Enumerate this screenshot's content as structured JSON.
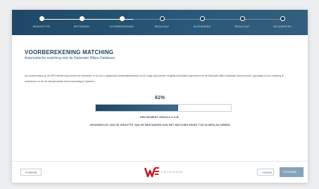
{
  "stepper": {
    "steps": [
      {
        "label": "WONINGTYPE"
      },
      {
        "label": "BESTANDEN"
      },
      {
        "label": "VOORBEREKENING"
      },
      {
        "label": "RESULTAAT"
      },
      {
        "label": "WIJZIGINGEN"
      },
      {
        "label": "RESULTAAT"
      },
      {
        "label": "DOCUMENTEN"
      }
    ],
    "completed_steps": 3
  },
  "main": {
    "title": "VOORBEREKENING MATCHING",
    "subtitle": "Automatische matching met de Nationale Milieu Database",
    "paragraph": "Als voorbereiding op de MPG Berekening worden de elementen in de door u geüploade bestandsbestanden uit de vorige stap worden mogelijk automatisch gematcht met de Nationale Milieu Database (hierna wordt u gevraagd om de matching te controleren en om de niet gematchte items handmatig te matchen.",
    "progress_label": "61%",
    "progress_value": 61,
    "wait_text": "EEN MOMENT GEDULD A.U.B.",
    "note_text": "AFHANKELIJK VAN DE GROOTTE VAN DE BESTANDEN KAN HET MATCHEN ENIGE TIJD IN BESLAG NEMEN"
  },
  "footer": {
    "stop_label": "STOPPEN",
    "logo_text": "ARCHIBASE",
    "prev_label": "← VORIGE",
    "next_label": "VOLGENDE →"
  },
  "colors": {
    "stepper_bg": "#1f4866",
    "accent": "#1e3f5a",
    "logo_red": "#c41e2a",
    "next_button": "#86a3bb"
  }
}
